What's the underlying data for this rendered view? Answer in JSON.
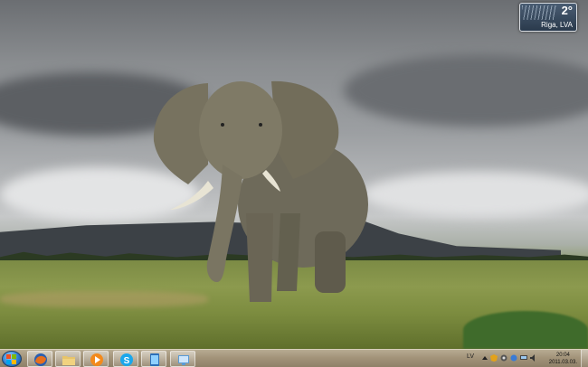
{
  "weather_gadget": {
    "temperature": "2°",
    "location": "Riga, LVA"
  },
  "taskbar": {
    "start_icon": "windows-orb-icon",
    "pinned": [
      {
        "name": "taskbar-firefox",
        "icon": "firefox-icon"
      },
      {
        "name": "taskbar-explorer",
        "icon": "folder-icon"
      },
      {
        "name": "taskbar-media-player",
        "icon": "media-player-icon"
      },
      {
        "name": "taskbar-skype",
        "icon": "skype-icon"
      },
      {
        "name": "taskbar-tablet",
        "icon": "tablet-icon"
      },
      {
        "name": "taskbar-network",
        "icon": "network-app-icon"
      }
    ],
    "language": "LV",
    "tray_icons": [
      "show-hidden-icon",
      "security-icon",
      "settings-icon",
      "update-icon",
      "network-icon",
      "volume-icon"
    ],
    "time": "20:04",
    "date": "2011.03.03."
  },
  "colors": {
    "taskbar": "#a3947a",
    "gadget": "#2a3a4c"
  }
}
